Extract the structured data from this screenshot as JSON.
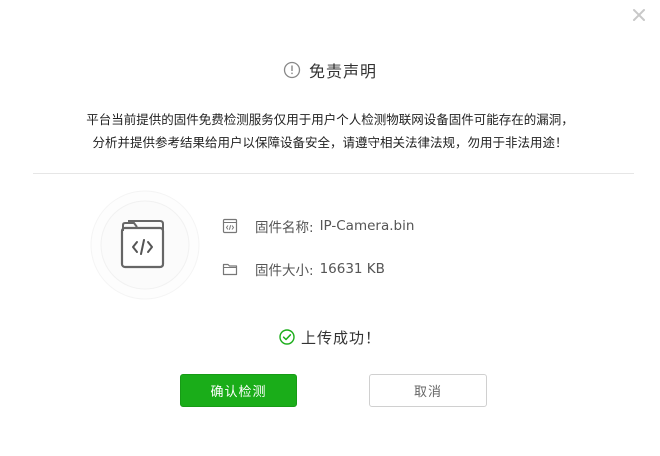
{
  "dialog": {
    "close_icon": "close-icon",
    "title": "免责声明",
    "title_icon": "info-icon",
    "notice_lines": [
      "平台当前提供的固件免费检测服务仅用于用户个人检测物联网设备固件可能存在的漏洞，",
      "分析并提供参考结果给用户以保障设备安全，请遵守相关法律法规，勿用于非法用途！"
    ],
    "file": {
      "graphic_icon": "code-folder-icon",
      "name_label": "固件名称:",
      "name_value": "IP-Camera.bin",
      "name_icon": "code-file-icon",
      "size_label": "固件大小:",
      "size_value": "16631 KB",
      "size_icon": "folder-icon"
    },
    "status": {
      "text": "上传成功！",
      "icon": "check-circle-icon",
      "color": "#1aad19"
    },
    "buttons": {
      "confirm_label": "确认检测",
      "cancel_label": "取消"
    },
    "colors": {
      "accent": "#1aad19"
    }
  }
}
